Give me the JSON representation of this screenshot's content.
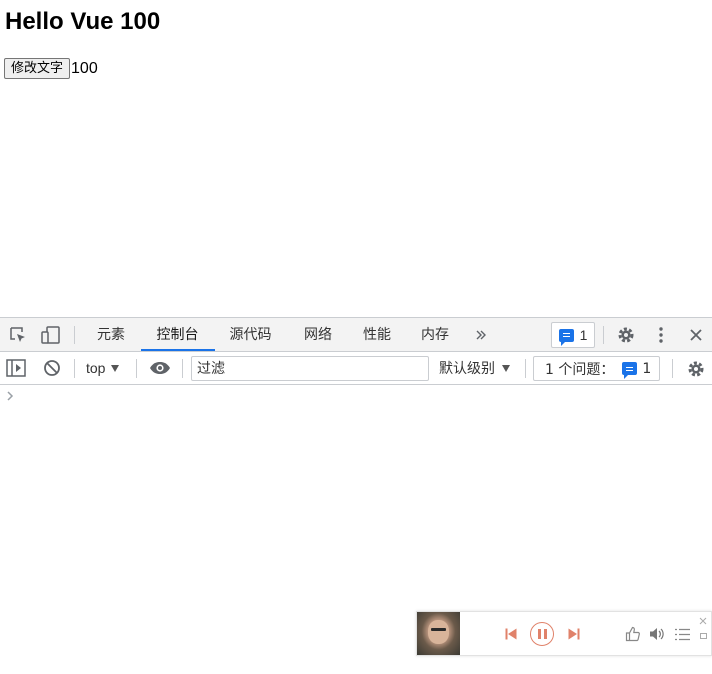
{
  "page": {
    "heading": "Hello Vue 100",
    "button_label": "修改文字",
    "count_text": "100"
  },
  "devtools": {
    "tabs": [
      {
        "label": "元素"
      },
      {
        "label": "控制台"
      },
      {
        "label": "源代码"
      },
      {
        "label": "网络"
      },
      {
        "label": "性能"
      },
      {
        "label": "内存"
      }
    ],
    "active_tab": "控制台",
    "more_tabs_icon": "chevron-double-right-icon",
    "message_count": "1",
    "toolbar": {
      "context": "top",
      "filter_placeholder": "过滤",
      "log_level": "默认级别",
      "issues_label": "1 个问题：",
      "issues_count": "1"
    },
    "colors": {
      "accent": "#1a73e8",
      "border": "#cacdd1",
      "tabbar_bg": "#f3f3f3"
    }
  },
  "player": {
    "controls": [
      "previous-icon",
      "pause-icon",
      "next-icon",
      "thumbs-up-icon",
      "volume-icon",
      "playlist-icon"
    ],
    "accent": "#e0826a"
  }
}
